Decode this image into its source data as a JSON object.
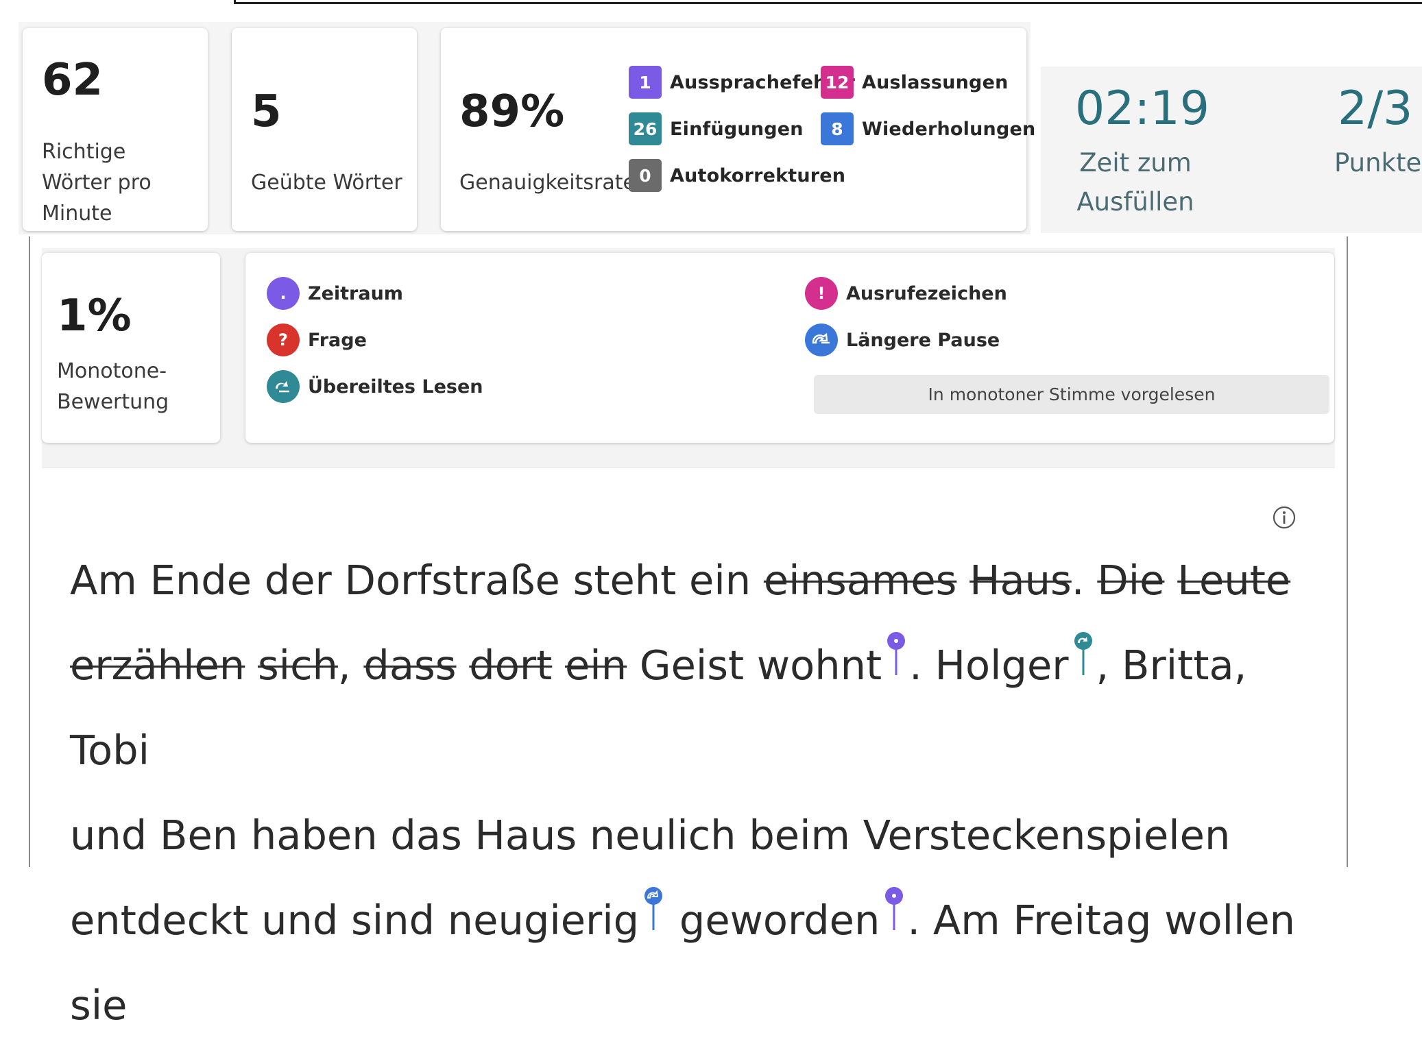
{
  "stats": {
    "wpm": {
      "value": "62",
      "label_lines": [
        "Richtige",
        "Wörter pro",
        "Minute"
      ]
    },
    "practiced": {
      "value": "5",
      "label": "Geübte Wörter"
    },
    "accuracy": {
      "value": "89%",
      "label": "Genauigkeitsrate"
    }
  },
  "accuracy_badges": [
    {
      "count": "1",
      "label": "Aussprachefehler",
      "color": "#7b5be6"
    },
    {
      "count": "12",
      "label": "Auslassungen",
      "color": "#d42f8f"
    },
    {
      "count": "26",
      "label": "Einfügungen",
      "color": "#2f8a95"
    },
    {
      "count": "8",
      "label": "Wiederholungen",
      "color": "#3a77d8"
    },
    {
      "count": "0",
      "label": "Autokorrekturen",
      "color": "#6b6b6b"
    }
  ],
  "timer": {
    "time": "02:19",
    "time_label_lines": [
      "Zeit zum",
      "Ausfüllen"
    ],
    "points": "2/3",
    "points_label": "Punkte"
  },
  "monotone": {
    "value": "1%",
    "label_lines": [
      "Monotone-",
      "Bewertung"
    ]
  },
  "legend": [
    {
      "label": "Zeitraum",
      "icon": "period-icon",
      "color": "#7b5be6",
      "glyph": "."
    },
    {
      "label": "Frage",
      "icon": "question-icon",
      "color": "#d9342b",
      "glyph": "?"
    },
    {
      "label": "Übereiltes Lesen",
      "icon": "rushed-reading-icon",
      "color": "#2f8a95",
      "glyph": ""
    },
    {
      "label": "Ausrufezeichen",
      "icon": "exclamation-icon",
      "color": "#d42f8f",
      "glyph": "!"
    },
    {
      "label": "Längere Pause",
      "icon": "long-pause-icon",
      "color": "#3a77d8",
      "glyph": ""
    }
  ],
  "monotone_button": "In monotoner Stimme vorgelesen",
  "passage": {
    "segments": [
      "Am Ende der Dorfstraße steht ein ",
      "einsames",
      " ",
      "Haus",
      ". ",
      "Die",
      " ",
      "Leute",
      "erzählen",
      " ",
      "sich",
      ", ",
      "dass",
      " ",
      "dort",
      " ",
      "ein",
      " Geist wohnt",
      ". Holger",
      ", Britta, Tobi",
      "und Ben haben das Haus neulich beim Versteckenspielen",
      "entdeckt und sind neugierig",
      " geworden",
      ". Am Freitag wollen sie"
    ]
  }
}
